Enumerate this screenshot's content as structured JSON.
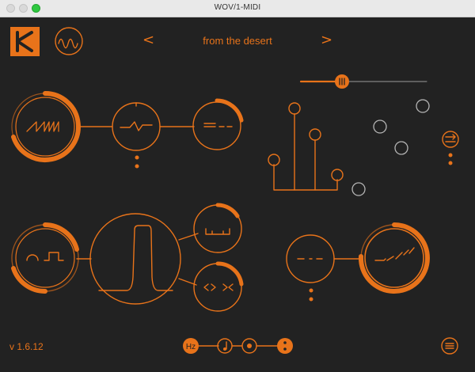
{
  "window": {
    "title": "WOV/1-MIDI"
  },
  "header": {
    "prev_label": "<",
    "next_label": ">",
    "preset_name": "from the desert"
  },
  "footer": {
    "version": "v 1.6.12",
    "hz_label": "Hz"
  },
  "colors": {
    "accent": "#e8731a",
    "background": "#222222",
    "inactive": "#b5b5b5"
  },
  "icons": [
    "k-logo-icon",
    "wave-logo-icon",
    "menu-icon",
    "note-icon",
    "dot-icon",
    "dots-icon",
    "route-icon"
  ]
}
